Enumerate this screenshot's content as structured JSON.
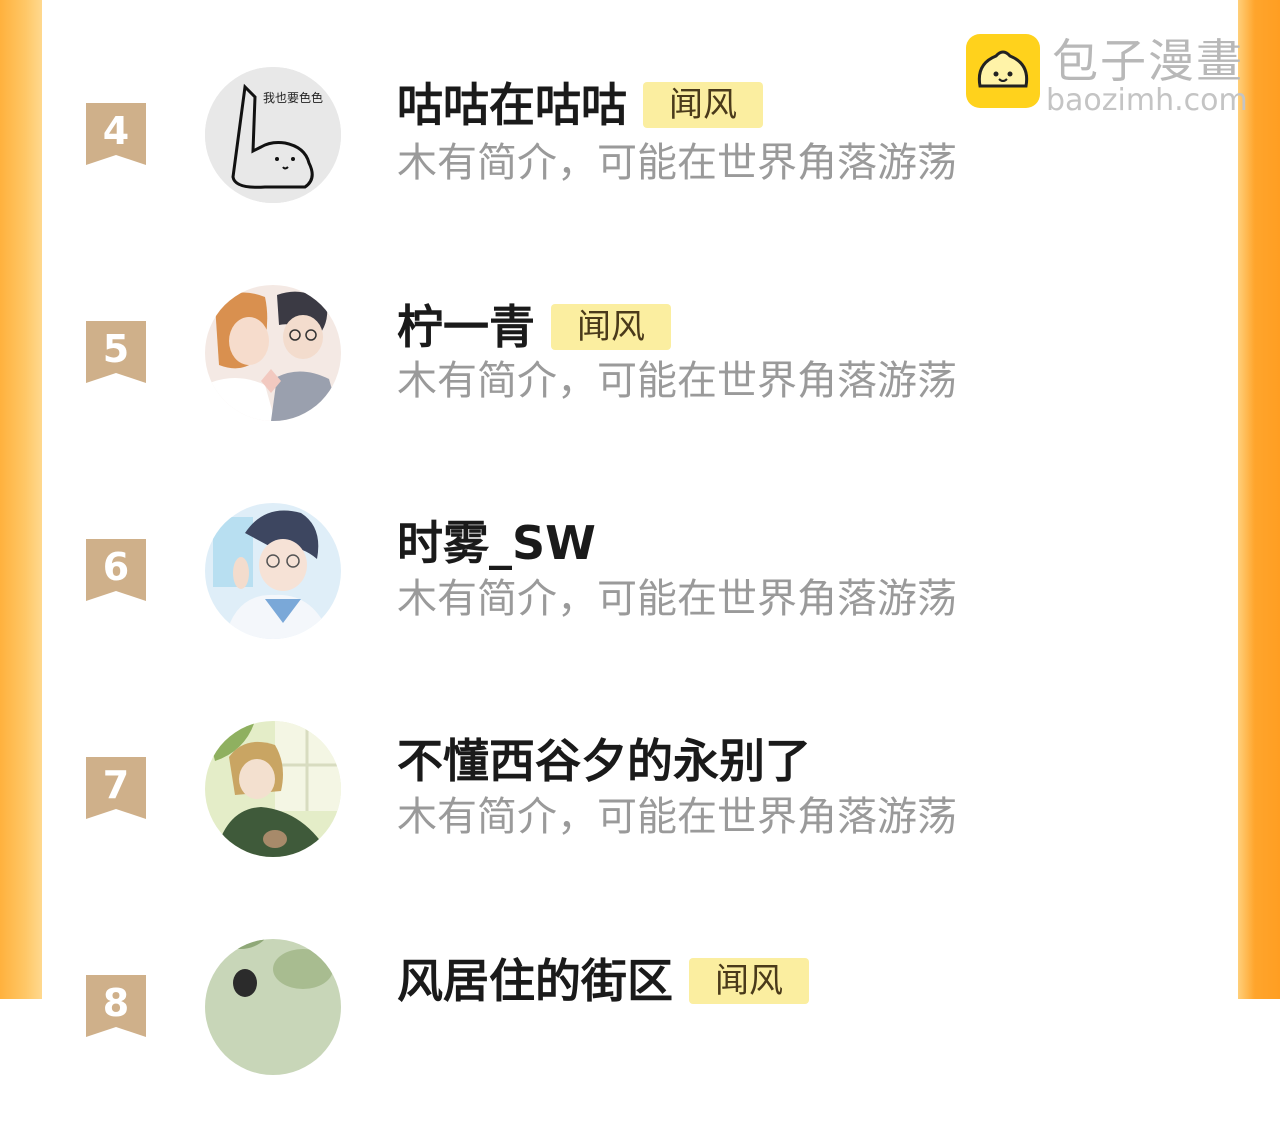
{
  "watermark": {
    "brand": "包子漫畫",
    "url": "baozimh.com"
  },
  "colors": {
    "accent": "#ffa52c",
    "tag_bg": "#fbeea0",
    "rank_badge": "#cfb08a"
  },
  "entries": [
    {
      "rank": "4",
      "name": "咕咕在咕咕",
      "tag": "闻风",
      "intro": "木有简介，可能在世界角落游荡",
      "avatar_icon": "cat-sketch-avatar",
      "avatar_caption": "我也要色色"
    },
    {
      "rank": "5",
      "name": "柠一青",
      "tag": "闻风",
      "intro": "木有简介，可能在世界角落游荡",
      "avatar_icon": "anime-couple-avatar"
    },
    {
      "rank": "6",
      "name": "时雾_SW",
      "tag": "",
      "intro": "木有简介，可能在世界角落游荡",
      "avatar_icon": "anime-boy-glasses-avatar"
    },
    {
      "rank": "7",
      "name": "不懂西谷夕的永别了",
      "tag": "",
      "intro": "木有简介，可能在世界角落游荡",
      "avatar_icon": "anime-character-window-avatar"
    },
    {
      "rank": "8",
      "name": "风居住的街区",
      "tag": "闻风",
      "intro": "",
      "avatar_icon": "garden-scene-avatar"
    }
  ]
}
